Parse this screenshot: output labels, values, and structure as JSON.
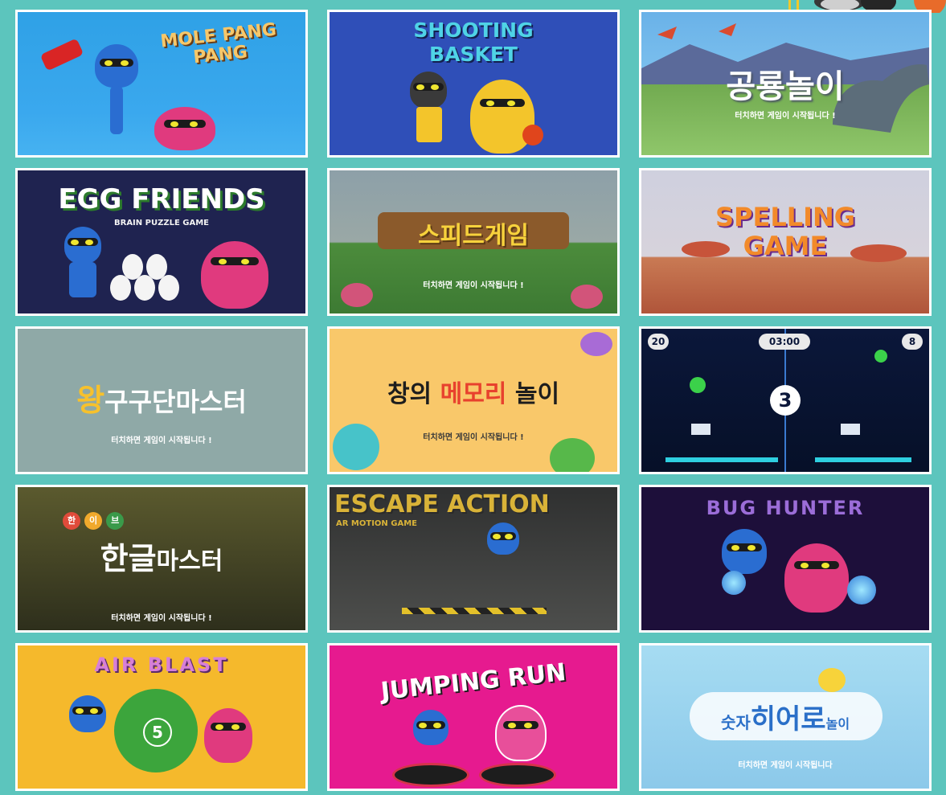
{
  "games": [
    {
      "title": "MOLE PANG PANG",
      "subtitle": "",
      "bg": "#2f9fe3",
      "accent": "#f6c76a"
    },
    {
      "title": "SHOOTING BASKET",
      "subtitle": "",
      "bg": "#2e4fb6",
      "accent": "#4fd3e6"
    },
    {
      "title": "공룡놀이",
      "subtitle": "터치하면 게임이 시작됩니다 !",
      "bg": "#7bb46a",
      "accent": "#ffffff"
    },
    {
      "title": "EGG FRIENDS",
      "subtitle": "BRAIN PUZZLE GAME",
      "bg": "#1f2350",
      "accent": "#ffffff"
    },
    {
      "title": "스피드게임",
      "subtitle": "터치하면 게임이 시작됩니다 !",
      "bg": "#5f8a4e",
      "accent": "#f7d23c"
    },
    {
      "title": "SPELLING GAME",
      "subtitle": "",
      "bg": "#c9c9d9",
      "accent": "#f28a2a"
    },
    {
      "title": "구구단마스터",
      "title_prefix": "왕",
      "subtitle": "터치하면 게임이 시작됩니다 !",
      "bg": "#8fa9a7",
      "accent": "#f7c12c"
    },
    {
      "title_prefix": "창의",
      "title_highlight": "메모리",
      "title": "놀이",
      "subtitle": "터치하면 게임이 시작됩니다 !",
      "bg": "#f9c86a",
      "accent": "#e8412d"
    },
    {
      "title": "",
      "subtitle": "",
      "bg": "#0a1534",
      "accent": "#ffffff",
      "hud": {
        "left_score": "20",
        "timer": "03:00",
        "right_score": "8",
        "countdown": "3"
      }
    },
    {
      "title_prefix": "한글",
      "title": "마스터",
      "badge": [
        "한",
        "이",
        "브"
      ],
      "subtitle": "터치하면 게임이 시작됩니다 !",
      "bg": "#3d3f22",
      "accent": "#ffffff"
    },
    {
      "title": "ESCAPE ACTION",
      "subtitle": "AR MOTION GAME",
      "bg": "#3a3b3a",
      "accent": "#d9b338"
    },
    {
      "title": "BUG HUNTER",
      "subtitle": "",
      "bg": "#1d0f3a",
      "accent": "#9b6dd8"
    },
    {
      "title": "AIR BLAST",
      "subtitle": "",
      "bg": "#f5b92c",
      "accent": "#d77fd7",
      "ball_number": "5"
    },
    {
      "title": "JUMPING RUN",
      "subtitle": "",
      "bg": "#e61a8f",
      "accent": "#ffffff"
    },
    {
      "title_prefix": "숫자",
      "title_highlight": "히어로",
      "title": "놀이",
      "subtitle": "터치하면 게임이 시작됩니다",
      "bg": "#92d3ee",
      "accent": "#2a6fc8"
    }
  ]
}
